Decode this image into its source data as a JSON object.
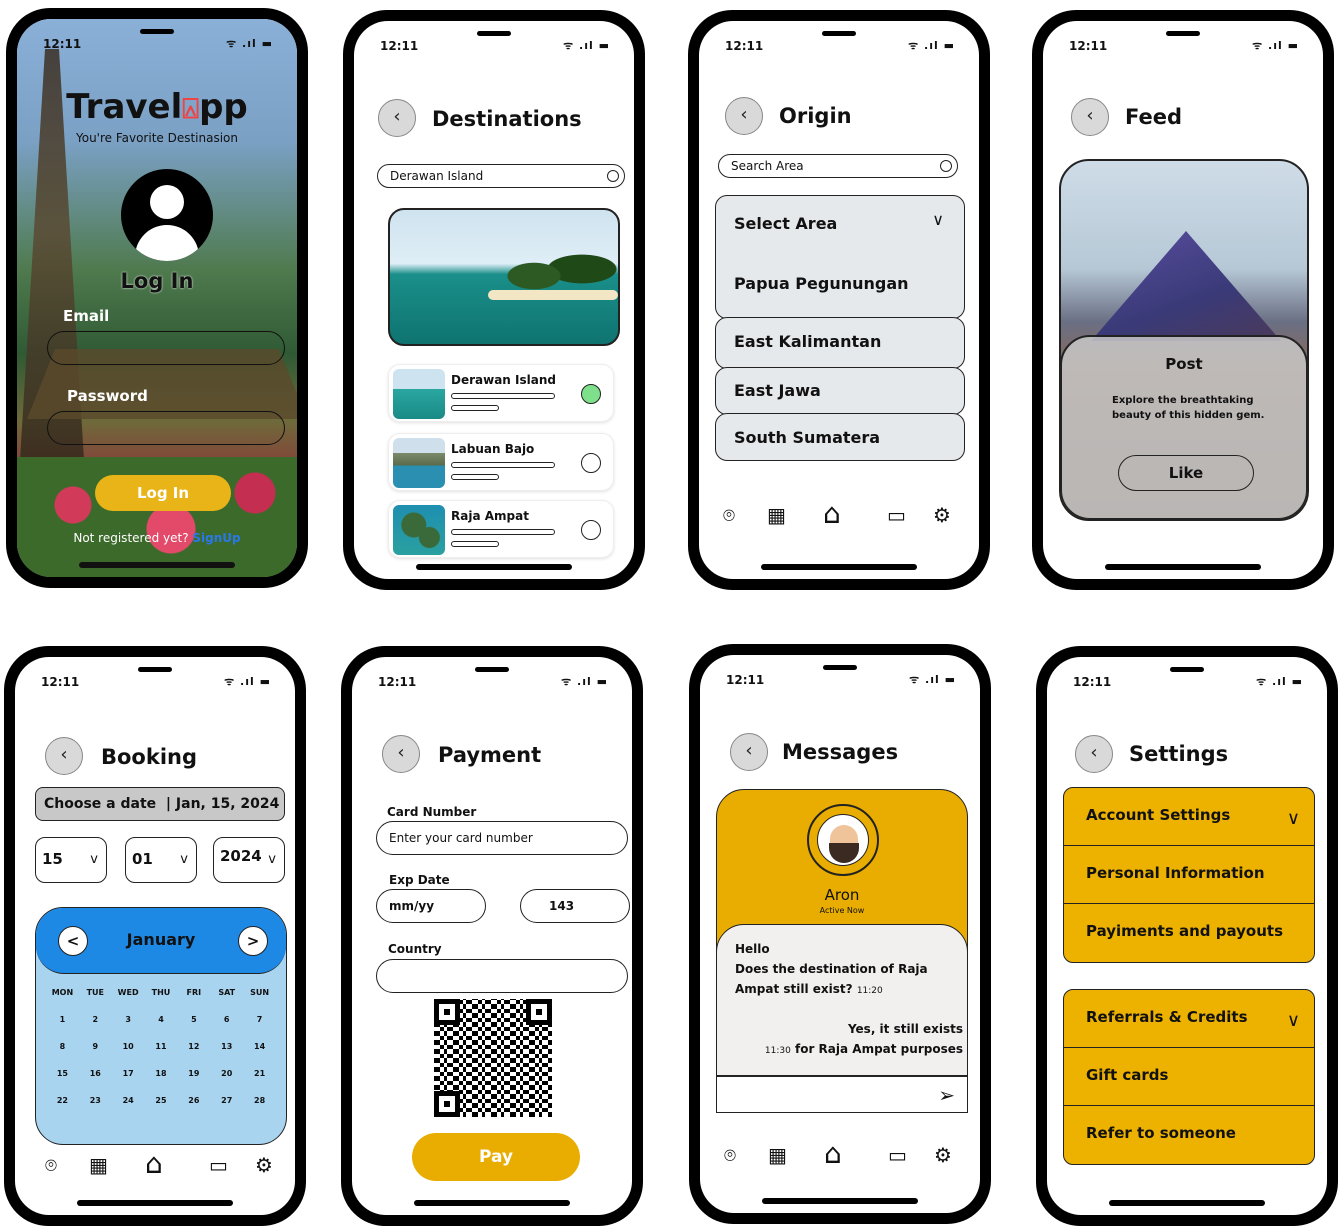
{
  "status": {
    "time": "12:11",
    "icons": "ᯤ .ıl ▬"
  },
  "login": {
    "logo": "Travel",
    "logo_suffix": "pp",
    "tagline": "You're Favorite Destinasion",
    "title": "Log In",
    "email_label": "Email",
    "password_label": "Password",
    "button": "Log In",
    "not_registered": "Not registered yet?",
    "signup": "SignUp"
  },
  "destinations": {
    "title": "Destinations",
    "search_value": "Derawan Island",
    "items": [
      {
        "name": "Derawan Island",
        "selected": true
      },
      {
        "name": "Labuan Bajo",
        "selected": false
      },
      {
        "name": "Raja Ampat",
        "selected": false
      }
    ]
  },
  "origin": {
    "title": "Origin",
    "search_placeholder": "Search Area",
    "select_label": "Select Area",
    "areas": [
      "Papua Pegunungan",
      "East Kalimantan",
      "East Jawa",
      "South Sumatera"
    ]
  },
  "feed": {
    "title": "Feed",
    "post_title": "Post",
    "post_body": "Explore the breathtaking beauty of this hidden gem.",
    "like": "Like"
  },
  "booking": {
    "title": "Booking",
    "choose_label": "Choose a date",
    "date_value": "Jan, 15, 2024",
    "day": "15",
    "month": "01",
    "year": "2024",
    "dropdown_glyph": "v",
    "calendar_month": "January",
    "weekdays": [
      "MON",
      "TUE",
      "WED",
      "THU",
      "FRI",
      "SAT",
      "SUN"
    ],
    "days": [
      "1",
      "2",
      "3",
      "4",
      "5",
      "6",
      "7",
      "8",
      "9",
      "10",
      "11",
      "12",
      "13",
      "14",
      "15",
      "16",
      "17",
      "18",
      "19",
      "20",
      "21",
      "22",
      "23",
      "24",
      "25",
      "26",
      "27",
      "28"
    ]
  },
  "payment": {
    "title": "Payment",
    "card_label": "Card Number",
    "card_placeholder": "Enter your card number",
    "exp_label": "Exp Date",
    "exp_value": "mm/yy",
    "cvv_value": "143",
    "country_label": "Country",
    "pay_button": "Pay"
  },
  "messages": {
    "title": "Messages",
    "contact_name": "Aron",
    "contact_status": "Active Now",
    "incoming_1": "Hello",
    "incoming_2": "Does the destination of Raja",
    "incoming_3": "Ampat still exist?",
    "incoming_time": "11:20",
    "outgoing_1": "Yes, it still exists",
    "outgoing_time": "11:30",
    "outgoing_2": "for Raja Ampat purposes"
  },
  "settings": {
    "title": "Settings",
    "group1": [
      "Account Settings",
      "Personal Information",
      "Payiments and payouts"
    ],
    "group2": [
      "Referrals & Credits",
      "Gift cards",
      "Refer to someone"
    ]
  },
  "nav_icons": [
    "location-icon",
    "calendar-icon",
    "home-icon",
    "chat-icon",
    "settings-icon"
  ]
}
